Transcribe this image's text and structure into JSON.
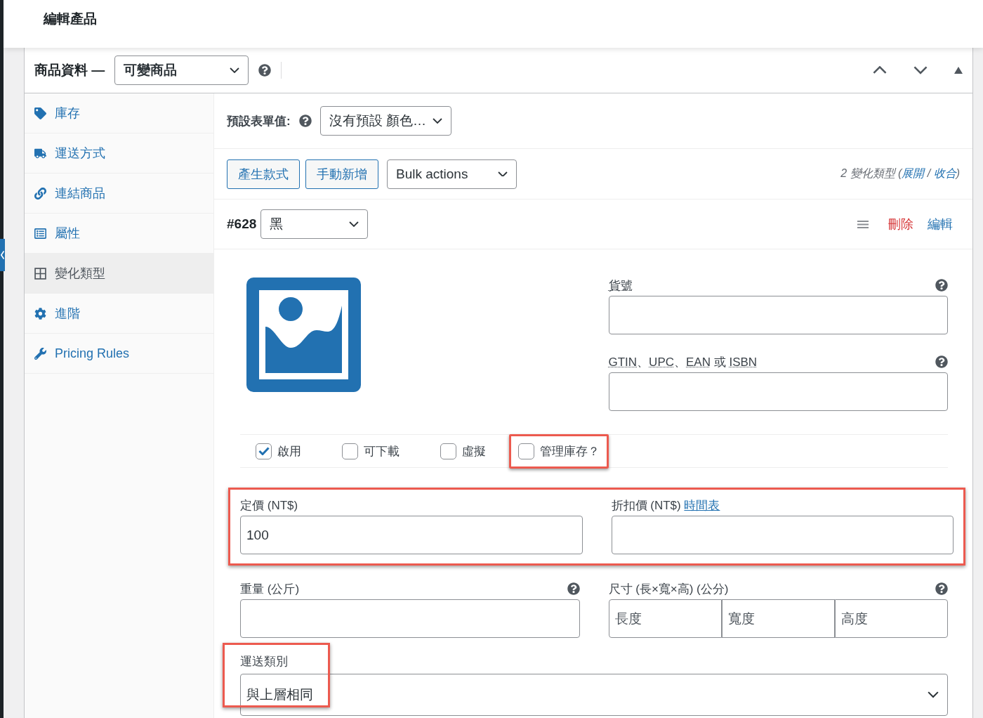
{
  "page_title": "編輯產品",
  "product_data": {
    "label": "商品資料 —",
    "type_select": "可變商品"
  },
  "sidebar": {
    "items": [
      {
        "label": "庫存",
        "selected": false
      },
      {
        "label": "運送方式",
        "selected": false
      },
      {
        "label": "連結商品",
        "selected": false
      },
      {
        "label": "屬性",
        "selected": false
      },
      {
        "label": "變化類型",
        "selected": true
      },
      {
        "label": "進階",
        "selected": false
      },
      {
        "label": "Pricing Rules",
        "selected": false
      }
    ]
  },
  "defaults": {
    "label": "預設表單值:",
    "select": "沒有預設 顏色…"
  },
  "actions": {
    "buttons": [
      "產生款式",
      "手動新增"
    ],
    "bulk_select": "Bulk actions",
    "summary_prefix": "2 變化類型 (",
    "expand": "展開",
    "separator": " / ",
    "collapse": "收合",
    "summary_suffix": ")"
  },
  "variation": {
    "id": "#628",
    "option": "黑",
    "delete": "刪除",
    "edit": "編輯",
    "sku": {
      "label": "貨號"
    },
    "gtin": {
      "label_parts": [
        {
          "text": "GTIN",
          "abbr": true
        },
        {
          "text": "、",
          "abbr": false
        },
        {
          "text": "UPC",
          "abbr": true
        },
        {
          "text": "、",
          "abbr": false
        },
        {
          "text": "EAN",
          "abbr": true
        },
        {
          "text": " 或 ",
          "abbr": false
        },
        {
          "text": "ISBN",
          "abbr": true
        }
      ]
    },
    "options": [
      {
        "label": "啟用",
        "checked": true,
        "highlighted": false
      },
      {
        "label": "可下載",
        "checked": false,
        "highlighted": false
      },
      {
        "label": "虛擬",
        "checked": false,
        "highlighted": false
      },
      {
        "label": "管理庫存？",
        "checked": false,
        "highlighted": true
      }
    ],
    "pricing": {
      "highlighted": true,
      "regular": {
        "label": "定價 (NT$)",
        "value": "100"
      },
      "sale": {
        "label": "折扣價 (NT$)",
        "link": "時間表"
      }
    },
    "weight": {
      "label": "重量 (公斤)"
    },
    "dimensions": {
      "label": "尺寸 (長×寬×高) (公分)",
      "placeholders": [
        "長度",
        "寬度",
        "高度"
      ]
    },
    "shipping": {
      "label": "運送類別",
      "value": "與上層相同",
      "highlighted": true
    }
  }
}
